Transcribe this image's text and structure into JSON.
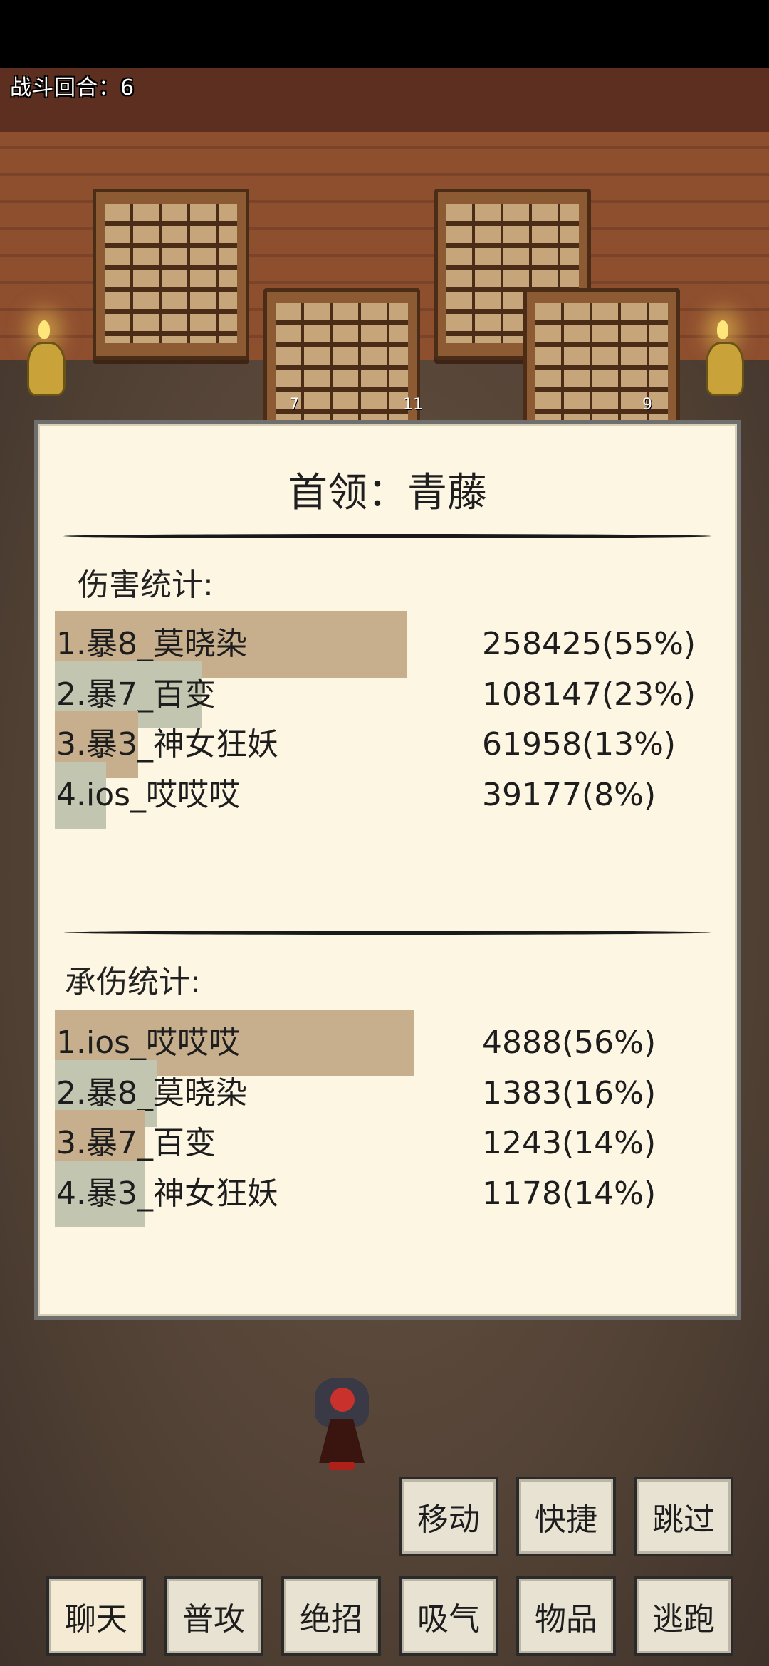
{
  "battle": {
    "round_label": "战斗回合：6"
  },
  "markers": [
    "7",
    "11",
    "9"
  ],
  "boss_panel": {
    "title": "首领：青藤",
    "damage": {
      "title": "伤害统计:",
      "rows": [
        {
          "name": "1.暴8_莫晓染",
          "value": "258425(55%)",
          "fraction": 0.55
        },
        {
          "name": "2.暴7_百变",
          "value": "108147(23%)",
          "fraction": 0.23
        },
        {
          "name": "3.暴3_神女狂妖",
          "value": "61958(13%)",
          "fraction": 0.13
        },
        {
          "name": "4.ios_哎哎哎",
          "value": "39177(8%)",
          "fraction": 0.08
        }
      ]
    },
    "taken": {
      "title": "承伤统计:",
      "rows": [
        {
          "name": "1.ios_哎哎哎",
          "value": "4888(56%)",
          "fraction": 0.56
        },
        {
          "name": "2.暴8_莫晓染",
          "value": "1383(16%)",
          "fraction": 0.16
        },
        {
          "name": "3.暴7_百变",
          "value": "1243(14%)",
          "fraction": 0.14
        },
        {
          "name": "4.暴3_神女狂妖",
          "value": "1178(14%)",
          "fraction": 0.14
        }
      ]
    }
  },
  "actions": {
    "move": "移动",
    "quick": "快捷",
    "skip": "跳过",
    "chat": "聊天",
    "attack": "普攻",
    "ultimate": "绝招",
    "breathe": "吸气",
    "items": "物品",
    "flee": "逃跑"
  }
}
